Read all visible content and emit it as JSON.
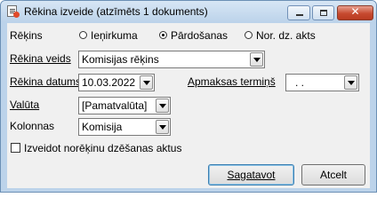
{
  "window": {
    "title": "Rēkina izveide (atzīmēts 1 dokuments)"
  },
  "form": {
    "type_label": "Rēķins",
    "radios": [
      {
        "label": "Ieņirkuma",
        "selected": false
      },
      {
        "label": "Pārdošanas",
        "selected": true
      },
      {
        "label": "Nor. dz. akts",
        "selected": false
      }
    ],
    "invoice_kind": {
      "label": "Rēkina veids",
      "value": "Komisijas rēķins"
    },
    "invoice_date": {
      "label": "Rēkina datums",
      "value": "10.03.2022"
    },
    "payment_term": {
      "label": "Apmaksas termiņš",
      "value": ". ."
    },
    "currency": {
      "label": "Valūta",
      "value": "[Pamatvalūta]"
    },
    "columns": {
      "label": "Kolonnas",
      "value": "Komisija"
    },
    "cancel_act": {
      "label": "Izveidot norēķinu dzēšanas aktus",
      "checked": false
    }
  },
  "buttons": {
    "create": "Sagatavot",
    "cancel": "Atcelt"
  }
}
